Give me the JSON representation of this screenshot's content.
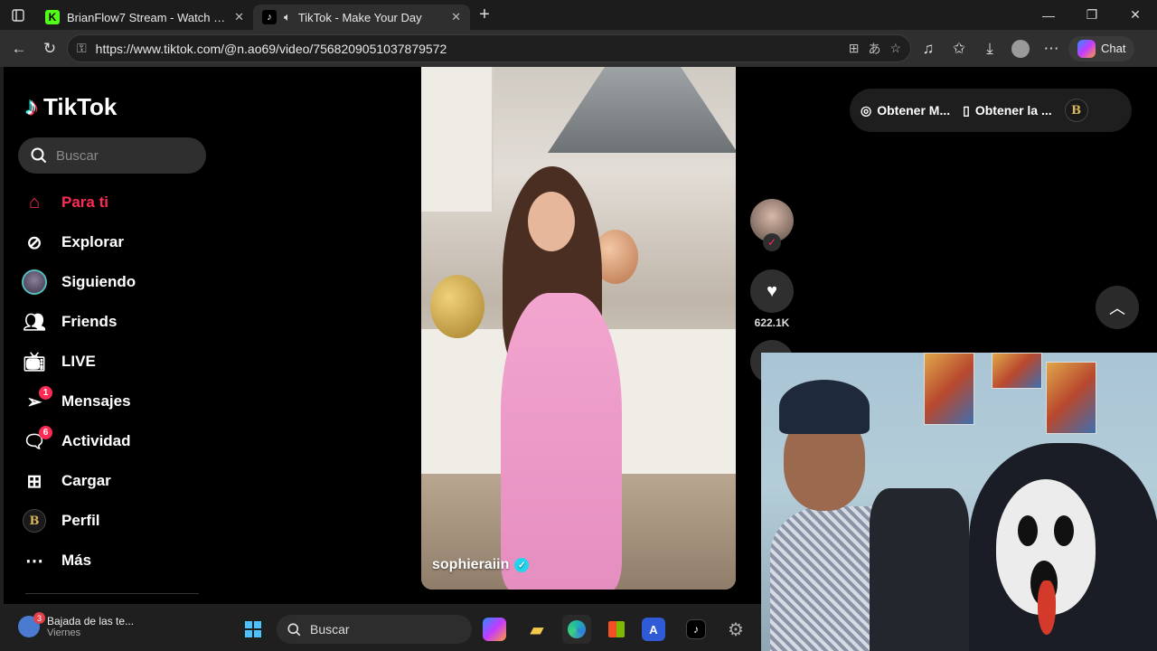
{
  "browser": {
    "tabs": [
      {
        "title": "BrianFlow7 Stream - Watch Live o",
        "favicon": "kick-icon"
      },
      {
        "title": "TikTok - Make Your Day",
        "favicon": "tiktok-icon"
      }
    ],
    "url": "https://www.tiktok.com/@n.ao69/video/7568209051037879572",
    "chat_label": "Chat"
  },
  "tiktok": {
    "logo_text": "TikTok",
    "search_placeholder": "Buscar",
    "nav": [
      {
        "label": "Para ti",
        "icon": "home-icon"
      },
      {
        "label": "Explorar",
        "icon": "compass-icon"
      },
      {
        "label": "Siguiendo",
        "icon": "following-avatar"
      },
      {
        "label": "Friends",
        "icon": "friends-icon"
      },
      {
        "label": "LIVE",
        "icon": "live-icon"
      },
      {
        "label": "Mensajes",
        "icon": "messages-icon",
        "badge": "1"
      },
      {
        "label": "Actividad",
        "icon": "activity-icon",
        "badge": "6"
      },
      {
        "label": "Cargar",
        "icon": "upload-icon"
      },
      {
        "label": "Perfil",
        "icon": "profile-icon"
      },
      {
        "label": "Más",
        "icon": "more-icon"
      }
    ],
    "top_right": {
      "get_coins": "Obtener M...",
      "get_app": "Obtener la ..."
    },
    "video": {
      "username": "sophieraiin",
      "likes": "622.1K"
    },
    "profile_logo": "B"
  },
  "taskbar": {
    "weather_badge": "3",
    "weather_title": "Bajada de las te...",
    "weather_sub": "Viernes",
    "search_label": "Buscar"
  },
  "colors": {
    "accent": "#fe2c55",
    "verified": "#20d5ec"
  }
}
